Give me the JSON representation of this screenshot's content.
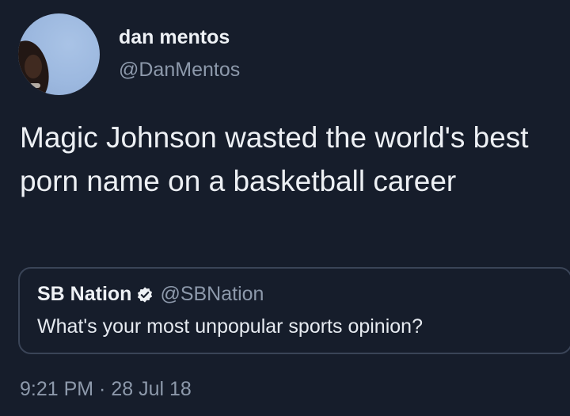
{
  "tweet": {
    "display_name": "dan mentos",
    "handle": "@DanMentos",
    "text": "Magic Johnson wasted the world's best porn name on a basketball career",
    "timestamp": "9:21 PM · 28 Jul 18"
  },
  "quoted_tweet": {
    "display_name": "SB Nation",
    "handle": "@SBNation",
    "verified_icon": "verified-badge-icon",
    "text": "What's your most unpopular sports opinion?"
  },
  "colors": {
    "background": "#161d2b",
    "primary_text": "#edf0f4",
    "secondary_text": "#8d99ab",
    "card_border": "#3a4457"
  }
}
